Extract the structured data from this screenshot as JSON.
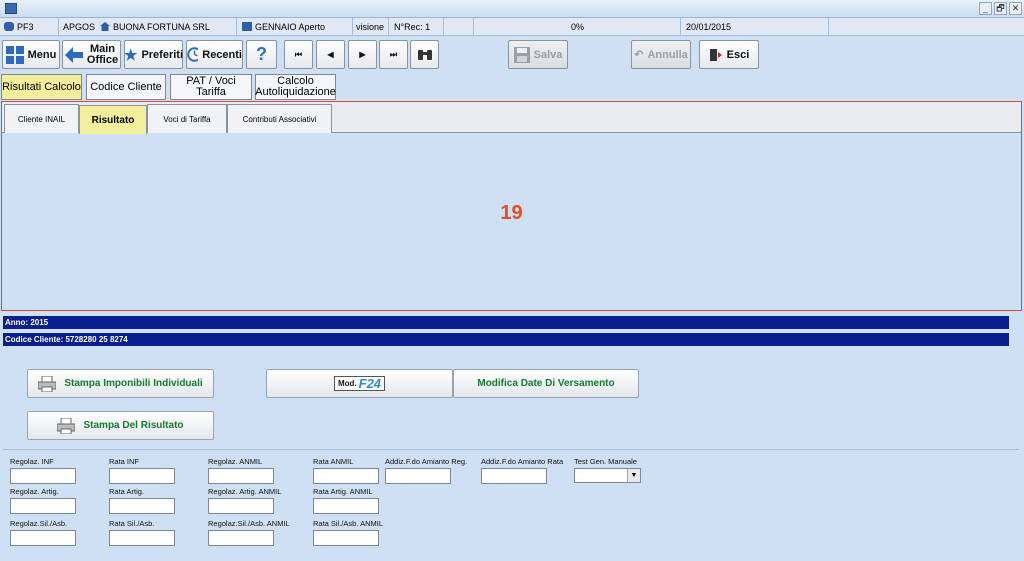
{
  "window": {
    "controls": [
      "_",
      "🗗",
      "✕"
    ]
  },
  "statusbar": {
    "user": "PF3",
    "module": "APGOS",
    "company": "BUONA FORTUNA SRL",
    "period": "GENNAIO Aperto",
    "mode": "visione",
    "rec": "N°Rec: 1",
    "progress": "0%",
    "date": "20/01/2015"
  },
  "toolbar": {
    "menu": "Menu",
    "main_office_1": "Main",
    "main_office_2": "Office",
    "preferiti": "Preferiti",
    "recenti": "Recenti",
    "help": "?",
    "salva": "Salva",
    "annulla": "Annulla",
    "esci": "Esci"
  },
  "func_buttons": {
    "risultati": "Risultati Calcolo",
    "codice": "Codice Cliente",
    "pat_1": "PAT / Voci",
    "pat_2": "Tariffa",
    "calcolo_1": "Calcolo",
    "calcolo_2": "Autoliquidazione"
  },
  "tabs": {
    "cliente": "Cliente INAIL",
    "risultato": "Risultato",
    "voci": "Voci di Tariffa",
    "contributi": "Contributi Associativi"
  },
  "panel_number": "19",
  "info": {
    "anno": "Anno: 2015",
    "codice": "Codice Cliente: 5728280 25 8274"
  },
  "actions": {
    "stampa_imponibili": "Stampa Imponibili Individuali",
    "mod_f24_prefix": "Mod.",
    "mod_f24": "F24",
    "modifica_date": "Modifica Date Di Versamento",
    "stampa_risultato": "Stampa Del Risultato"
  },
  "form": {
    "regolaz_inf": "Regolaz. INF",
    "rata_inf": "Rata INF",
    "regolaz_anmil": "Regolaz. ANMIL",
    "rata_anmil": "Rata ANMIL",
    "addiz_reg": "Addiz.F.do Amianto Reg.",
    "addiz_rata": "Addiz.F.do Amianto Rata",
    "test_gen": "Test Gen. Manuale",
    "regolaz_artig": "Regolaz. Artig.",
    "rata_artig": "Rata Artig.",
    "regolaz_artig_anmil": "Regolaz. Artig. ANMIL",
    "rata_artig_anmil": "Rata Artig. ANMIL",
    "regolaz_sil": "Regolaz.Sil./Asb.",
    "rata_sil": "Rata Sil./Asb.",
    "regolaz_sil_anmil": "Regolaz.Sil./Asb. ANMIL",
    "rata_sil_anmil": "Rata Sil./Asb. ANMIL"
  }
}
